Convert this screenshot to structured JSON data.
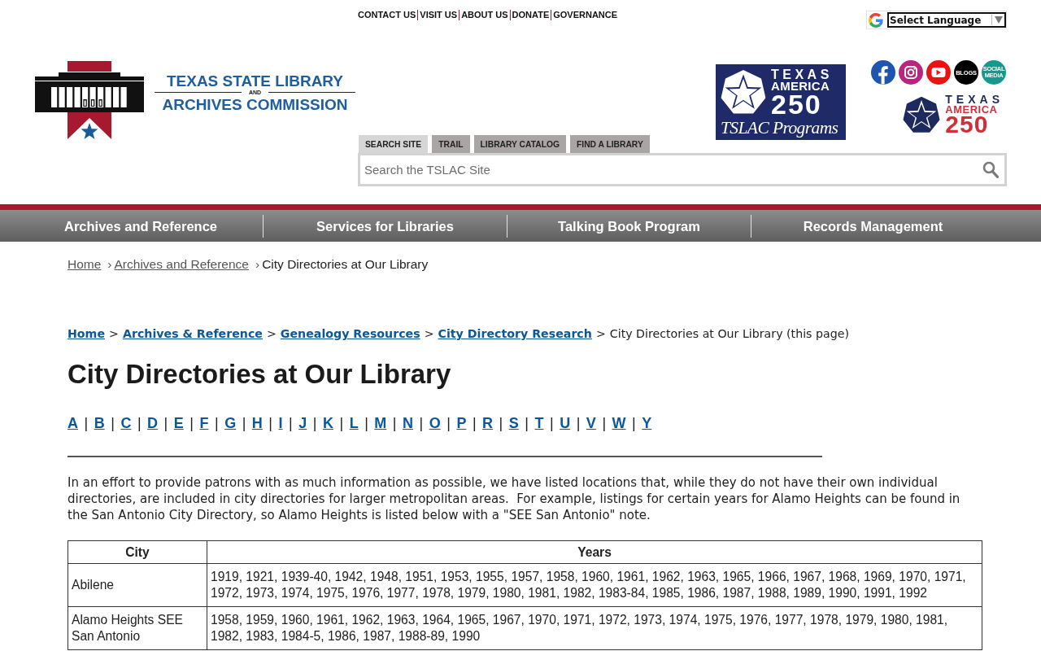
{
  "top_links": [
    "CONTACT US",
    "VISIT US",
    "ABOUT US",
    "DONATE",
    "GOVERNANCE"
  ],
  "language_select": {
    "value": "Select Language"
  },
  "logo": {
    "line_1": "TEXAS STATE LIBRARY",
    "line_2": "AND",
    "line_3": "ARCHIVES COMMISSION"
  },
  "promo_banner": {
    "line_1": "TEXAS",
    "line_2": "AMERICA",
    "line_3": "250",
    "line_4": "TSLAC Programs"
  },
  "social_links": [
    {
      "kind": "facebook"
    },
    {
      "kind": "instagram"
    },
    {
      "kind": "youtube"
    },
    {
      "kind": "blogs",
      "label": "BLOGS"
    },
    {
      "kind": "social",
      "label": "SOCIAL MEDIA"
    }
  ],
  "anniversary_logo": {
    "line_1": "TEXAS",
    "line_2": "AMERICA",
    "line_3": "250"
  },
  "search_tabs": [
    {
      "label": "SEARCH SITE",
      "selected": true
    },
    {
      "label": "TRAIL",
      "selected": false
    },
    {
      "label": "LIBRARY CATALOG",
      "selected": false
    },
    {
      "label": "FIND A LIBRARY",
      "selected": false
    }
  ],
  "search": {
    "placeholder": "Search the TSLAC Site"
  },
  "main_nav": [
    "Archives and Reference",
    "Services for Libraries",
    "Talking Book Program",
    "Records Management"
  ],
  "breadcrumb": {
    "separator": "›",
    "items": [
      {
        "label": "Home",
        "kind": "link"
      },
      {
        "label": "Archives and Reference",
        "kind": "link"
      },
      {
        "label": "City Directories at Our Library",
        "kind": "current"
      }
    ]
  },
  "page_trail": {
    "separator": ">",
    "items": [
      {
        "label": "Home",
        "kind": "link"
      },
      {
        "label": "Archives & Reference",
        "kind": "link"
      },
      {
        "label": "Genealogy Resources",
        "kind": "link"
      },
      {
        "label": "City Directory Research",
        "kind": "link"
      },
      {
        "label": "City Directories at Our Library (this page)",
        "kind": "current"
      }
    ]
  },
  "title": "City Directories at Our Library",
  "letter_index": {
    "separator": "|",
    "letters": [
      "A",
      "B",
      "C",
      "D",
      "E",
      "F",
      "G",
      "H",
      "I",
      "J",
      "K",
      "L",
      "M",
      "N",
      "O",
      "P",
      "R",
      "S",
      "T",
      "U",
      "V",
      "W",
      "Y"
    ]
  },
  "intro": "In an effort to provide patrons with as much information as possible, we have listed locations that, while they do not have their own individual directories, are included in city directories for larger metropolitan areas.  For example, listings for certain years for Alamo Heights can be found in the San Antonio City Directory, so Alamo Heights is listed below with a \"SEE San Antonio\" note.",
  "table": {
    "columns": [
      "City",
      "Years"
    ],
    "rows": [
      [
        "Abilene",
        "1919, 1921, 1939-40, 1942, 1948, 1951, 1953, 1955, 1957, 1958, 1960, 1961, 1962, 1963, 1965, 1966, 1967, 1968, 1969, 1970, 1971, 1972, 1973, 1974, 1975, 1976, 1977, 1978, 1979, 1980, 1981, 1982, 1983-84, 1985, 1986, 1987, 1988, 1989, 1990, 1991, 1992"
      ],
      [
        "Alamo Heights SEE San Antonio",
        "1958, 1959, 1960, 1961, 1962, 1963, 1964, 1965, 1967, 1970, 1971, 1972, 1973, 1974, 1975, 1976, 1977, 1978, 1979, 1980, 1981, 1982, 1983, 1984-5, 1986, 1987, 1988-89, 1990"
      ]
    ]
  }
}
